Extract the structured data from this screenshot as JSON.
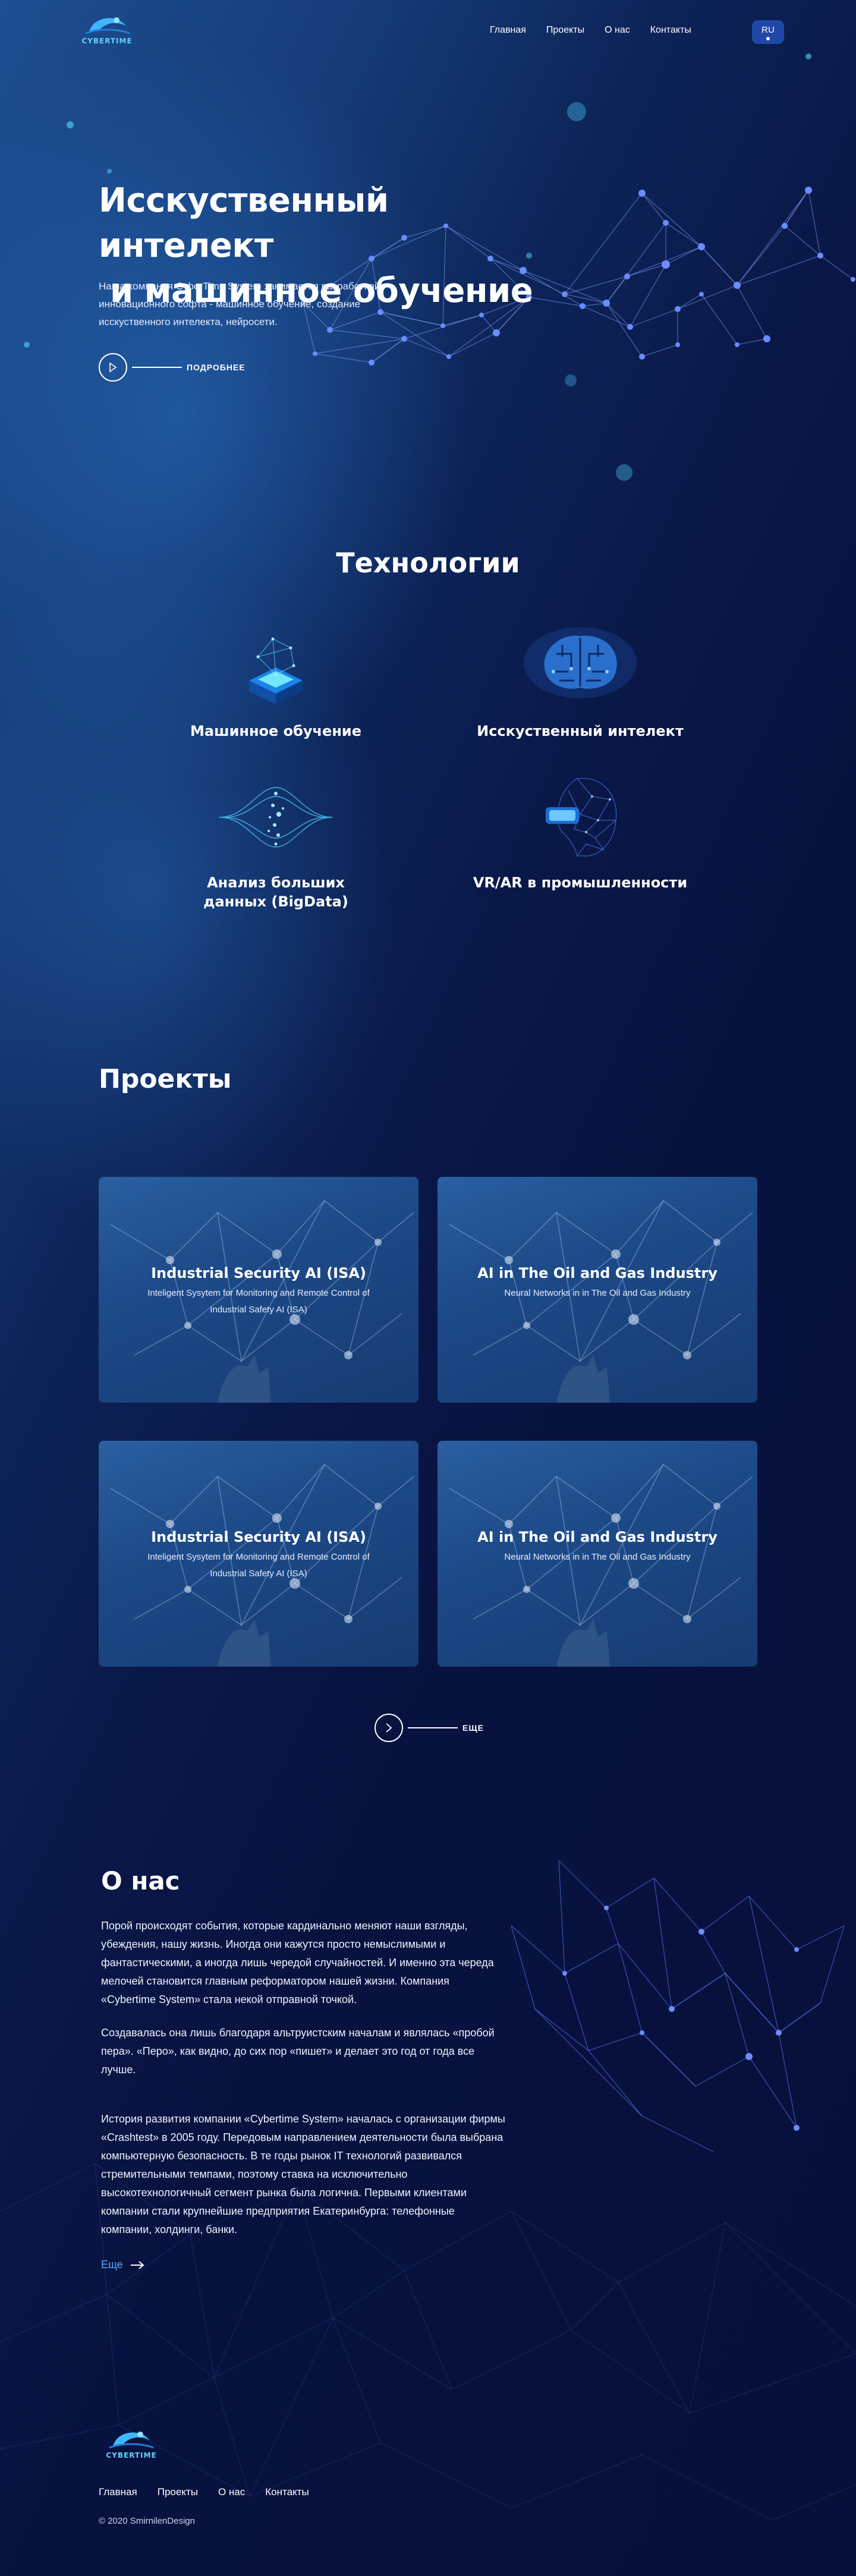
{
  "header": {
    "logo_text": "CYBERTIME",
    "nav": [
      "Главная",
      "Проекты",
      "О нас",
      "Контакты"
    ],
    "lang": "RU"
  },
  "hero": {
    "title_line1": "Исскуственный интелект",
    "title_line2": " и машинное обучение",
    "subtitle": "Наша компания CyberTime System занимается разработкой инновационного софта - машинное обучение, создание исскуственного интелекта, нейросети.",
    "more_label": "ПОДРОБНЕЕ"
  },
  "technologies": {
    "title": "Технологии",
    "items": [
      {
        "label": "Машинное обучение",
        "icon": "hologram-cube-icon"
      },
      {
        "label": "Исскуственный интелект",
        "icon": "circuit-brain-icon"
      },
      {
        "label": "Анализ больших данных (BigData)",
        "icon": "data-wave-icon"
      },
      {
        "label": "VR/AR в промышленности",
        "icon": "vr-head-icon"
      }
    ]
  },
  "projects": {
    "title": "Проекты",
    "cards": [
      {
        "title": "Industrial Security AI (ISA)",
        "subtitle": "Inteligent Sysytem for Monitoring and Remote Control of Industrial Safety AI (ISA)"
      },
      {
        "title": "AI in The Oil and Gas Industry",
        "subtitle": "Neural Networks in in The Oil and Gas Industry"
      },
      {
        "title": "Industrial Security AI (ISA)",
        "subtitle": "Inteligent Sysytem for Monitoring and Remote Control of Industrial Safety AI (ISA)"
      },
      {
        "title": "AI in The Oil and Gas Industry",
        "subtitle": "Neural Networks in in The Oil and Gas Industry"
      }
    ],
    "more_label": "ЕЩЕ"
  },
  "about": {
    "title": "О нас",
    "paragraphs": [
      "Порой происходят события, которые кардинально меняют наши взгляды, убеждения, нашу жизнь. Иногда они кажутся просто немыслимыми и фантастическими, а иногда лишь чередой случайностей. И именно эта череда мелочей становится главным реформатором нашей жизни. Компания «Cybertime System» стала некой отправной точкой.",
      "Создавалась она лишь благодаря альтруистским началам и являлась «пробой пера». «Перо», как видно, до сих пор «пишет» и делает это год от года все лучше.",
      "История развития компании «Cybertime System» началась с организации фирмы «Crashtest» в 2005 году. Передовым направлением деятельности была выбрана компьютерную безопасность. В те годы рынок IT технологий развивался стремительными темпами, поэтому ставка на исключительно высокотехнологичный сегмент рынка была логична. Первыми клиентами компании стали крупнейшие предприятия Екатеринбурга: телефонные компании, холдинги, банки."
    ],
    "more_label": "Еще"
  },
  "footer": {
    "logo_text": "CYBERTIME",
    "nav": [
      "Главная",
      "Проекты",
      "О нас",
      "Контакты"
    ],
    "copyright": "© 2020 SmirnilenDesign"
  },
  "colors": {
    "accent": "#60a7ff",
    "lang_bg": "#1f47a8",
    "node": "#6a8cff"
  }
}
